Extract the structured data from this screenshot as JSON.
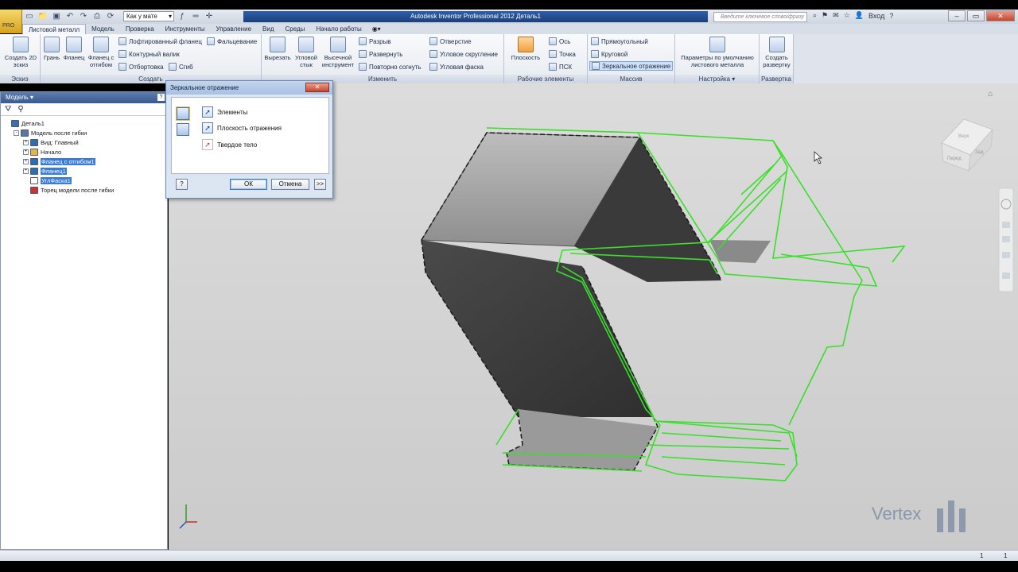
{
  "app": {
    "logo_text": "PRO",
    "title": "Autodesk Inventor Professional 2012   Деталь1",
    "appearance": "Как у мате",
    "search_placeholder": "Введите ключевое слово/фразу",
    "login": "Вход",
    "help": "?"
  },
  "tabs": [
    "Листовой металл",
    "Модель",
    "Проверка",
    "Инструменты",
    "Управление",
    "Вид",
    "Среды",
    "Начало работы"
  ],
  "ribbon": {
    "sketch": {
      "label": "Эскиз",
      "create_2d": "Создать 2D эскиз"
    },
    "create": {
      "label": "Создать",
      "face": "Грань",
      "flange": "Фланец",
      "contour_flange": "Фланец с отгибом",
      "lofted_flange": "Лофтированный фланец",
      "contour_roll": "Контурный валик",
      "flange_edge": "Отбортовка",
      "hem": "Фальцевание",
      "bend": "Сгиб"
    },
    "modify": {
      "label": "Изменить",
      "cut": "Вырезать",
      "corner_seam": "Угловой стык",
      "punch_tool": "Высечной инструмент",
      "rip": "Разрыв",
      "unfold": "Развернуть",
      "refold": "Повторно согнуть",
      "hole": "Отверстие",
      "corner_round": "Угловое скругление",
      "corner_chamfer": "Угловая фаска"
    },
    "work_features": {
      "label": "Рабочие элементы",
      "plane": "Плоскость",
      "axis": "Ось",
      "point": "Точка",
      "ucs": "ПСК"
    },
    "pattern": {
      "label": "Массив",
      "rectangular": "Прямоугольный",
      "circular": "Круговой",
      "mirror": "Зеркальное отражение"
    },
    "setup": {
      "label": "Настройка",
      "defaults": "Параметры по умолчанию листового металла"
    },
    "flat": {
      "label": "Развертка",
      "create_flat": "Создать развертку"
    }
  },
  "browser": {
    "title": "Модель",
    "help": "?",
    "tree": [
      {
        "label": "Деталь1",
        "indent": 0,
        "selected": false,
        "expander": "",
        "icon_color": "#3a6db5"
      },
      {
        "label": "Модель после гибки",
        "indent": 1,
        "selected": false,
        "expander": "-",
        "icon_color": "#5577aa"
      },
      {
        "label": "Вид: Главный",
        "indent": 2,
        "selected": false,
        "expander": "+",
        "icon_color": "#2c6fb0"
      },
      {
        "label": "Начало",
        "indent": 2,
        "selected": false,
        "expander": "+",
        "icon_color": "#e0b84a"
      },
      {
        "label": "Фланец с отгибом1",
        "indent": 2,
        "selected": true,
        "expander": "+",
        "icon_color": "#2c6fb0"
      },
      {
        "label": "Фланец1",
        "indent": 2,
        "selected": true,
        "expander": "+",
        "icon_color": "#2c6fb0"
      },
      {
        "label": "УглФаска1",
        "indent": 2,
        "selected": true,
        "expander": "",
        "icon_color": "#ffffff"
      },
      {
        "label": "Торец модели после гибки",
        "indent": 2,
        "selected": false,
        "expander": "",
        "icon_color": "#cc3333"
      }
    ]
  },
  "dialog": {
    "title": "Зеркальное отражение",
    "close": "✕",
    "elements": "Элементы",
    "mirror_plane": "Плоскость отражения",
    "solid": "Твердое тело",
    "ok": "ОК",
    "cancel": "Отмена",
    "more": ">>",
    "help": "?"
  },
  "statusbar": {
    "value1": "1",
    "value2": "1"
  },
  "viewcube": {
    "face_left": "Перед",
    "face_right": "Зад",
    "face_top": "Верх"
  },
  "watermark": "Vertex",
  "colors": {
    "accent": "#2f5fa8",
    "selection_green": "#3adf2a",
    "model_dark": "#3c3c3c",
    "model_light": "#9a9a9a"
  }
}
